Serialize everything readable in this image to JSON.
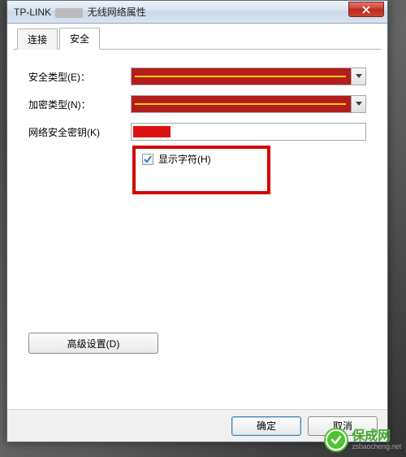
{
  "window": {
    "title_prefix": "TP-LINK",
    "title_suffix": "无线网络属性"
  },
  "tabs": {
    "connection": "连接",
    "security": "安全"
  },
  "form": {
    "security_type_label": "安全类型(E)：",
    "encryption_type_label": "加密类型(N)：",
    "network_key_label": "网络安全密钥(K)",
    "show_chars_label": "显示字符(H)"
  },
  "buttons": {
    "advanced": "高级设置(D)",
    "ok": "确定",
    "cancel": "取消"
  },
  "watermark": {
    "title": "保成网",
    "sub": "zsbaocheng.net"
  }
}
